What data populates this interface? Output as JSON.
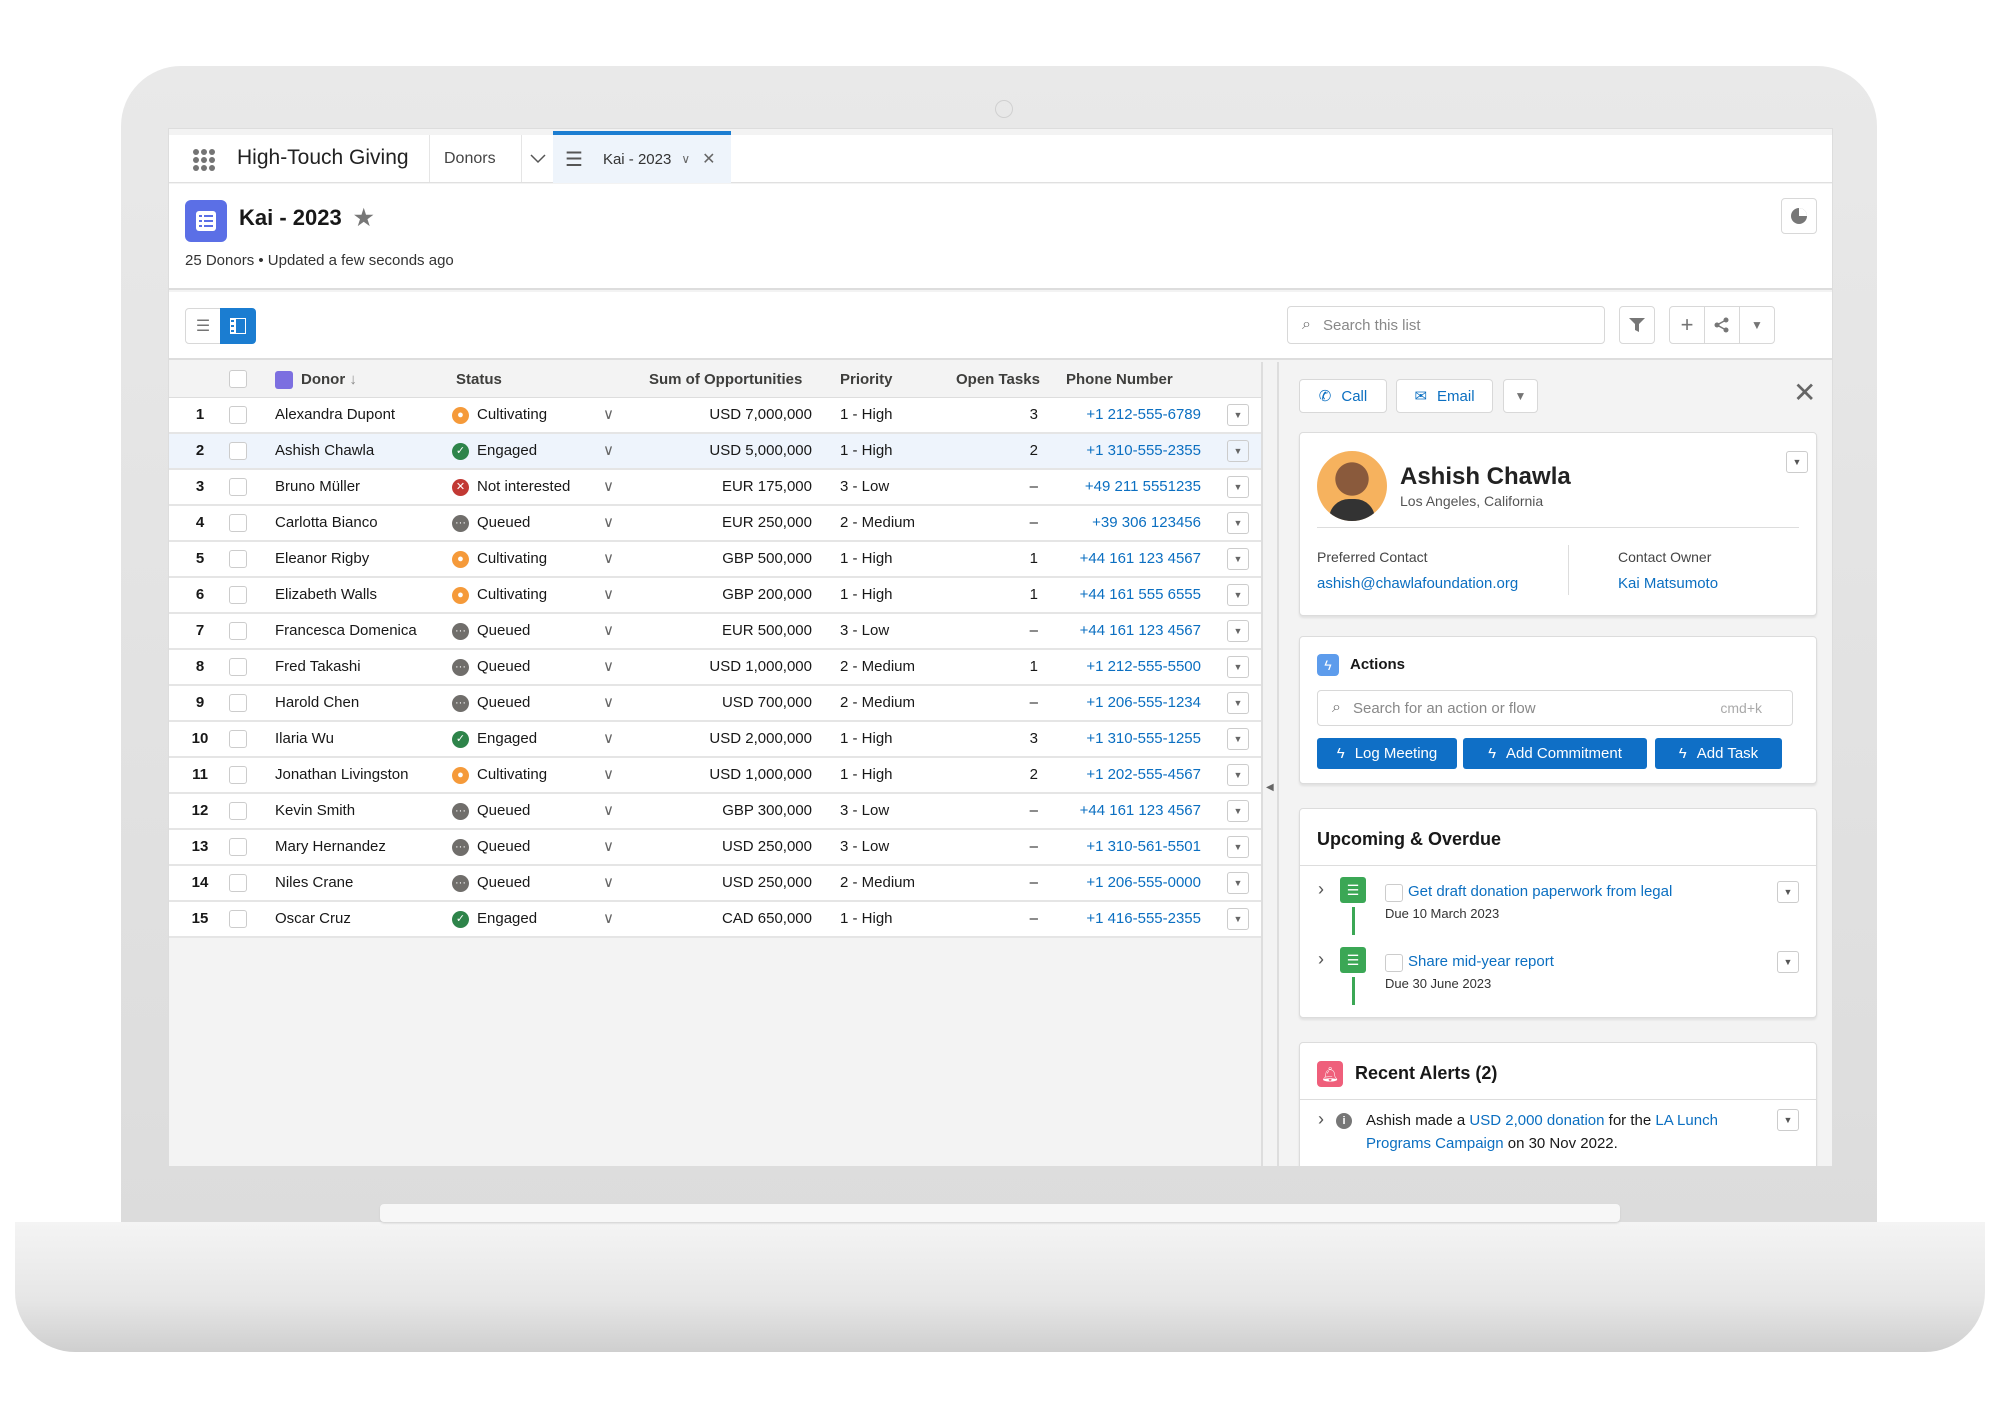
{
  "app": {
    "name": "High-Touch Giving",
    "nav_tab": "Donors",
    "active_tab": "Kai - 2023"
  },
  "header": {
    "title": "Kai - 2023",
    "subtitle": "25 Donors • Updated a few seconds ago"
  },
  "toolbar": {
    "search_placeholder": "Search this list"
  },
  "table": {
    "columns": {
      "donor": "Donor",
      "status": "Status",
      "sum": "Sum of Opportunities",
      "priority": "Priority",
      "tasks": "Open Tasks",
      "phone": "Phone Number"
    },
    "selected_row": 2,
    "status_colors": {
      "Cultivating": "#f59a3a",
      "Engaged": "#2e844a",
      "Not interested": "#c23934",
      "Queued": "#706e6b"
    },
    "rows": [
      {
        "n": "1",
        "donor": "Alexandra Dupont",
        "status": "Cultivating",
        "sum": "USD 7,000,000",
        "priority": "1 - High",
        "tasks": "3",
        "phone": "+1 212-555-6789"
      },
      {
        "n": "2",
        "donor": "Ashish Chawla",
        "status": "Engaged",
        "sum": "USD 5,000,000",
        "priority": "1 - High",
        "tasks": "2",
        "phone": "+1 310-555-2355"
      },
      {
        "n": "3",
        "donor": "Bruno Müller",
        "status": "Not interested",
        "sum": "EUR 175,000",
        "priority": "3 - Low",
        "tasks": "–",
        "phone": "+49 211 5551235"
      },
      {
        "n": "4",
        "donor": "Carlotta Bianco",
        "status": "Queued",
        "sum": "EUR 250,000",
        "priority": "2 - Medium",
        "tasks": "–",
        "phone": "+39 306 123456"
      },
      {
        "n": "5",
        "donor": "Eleanor Rigby",
        "status": "Cultivating",
        "sum": "GBP 500,000",
        "priority": "1 - High",
        "tasks": "1",
        "phone": "+44 161 123 4567"
      },
      {
        "n": "6",
        "donor": "Elizabeth Walls",
        "status": "Cultivating",
        "sum": "GBP 200,000",
        "priority": "1 - High",
        "tasks": "1",
        "phone": "+44 161 555 6555"
      },
      {
        "n": "7",
        "donor": "Francesca Domenica",
        "status": "Queued",
        "sum": "EUR 500,000",
        "priority": "3 - Low",
        "tasks": "–",
        "phone": "+44 161 123 4567"
      },
      {
        "n": "8",
        "donor": "Fred Takashi",
        "status": "Queued",
        "sum": "USD 1,000,000",
        "priority": "2 - Medium",
        "tasks": "1",
        "phone": "+1 212-555-5500"
      },
      {
        "n": "9",
        "donor": "Harold Chen",
        "status": "Queued",
        "sum": "USD 700,000",
        "priority": "2 - Medium",
        "tasks": "–",
        "phone": "+1 206-555-1234"
      },
      {
        "n": "10",
        "donor": "Ilaria Wu",
        "status": "Engaged",
        "sum": "USD 2,000,000",
        "priority": "1 - High",
        "tasks": "3",
        "phone": "+1 310-555-1255"
      },
      {
        "n": "11",
        "donor": "Jonathan Livingston",
        "status": "Cultivating",
        "sum": "USD 1,000,000",
        "priority": "1 - High",
        "tasks": "2",
        "phone": "+1 202-555-4567"
      },
      {
        "n": "12",
        "donor": "Kevin Smith",
        "status": "Queued",
        "sum": "GBP 300,000",
        "priority": "3 - Low",
        "tasks": "–",
        "phone": "+44 161 123 4567"
      },
      {
        "n": "13",
        "donor": "Mary Hernandez",
        "status": "Queued",
        "sum": "USD 250,000",
        "priority": "3 - Low",
        "tasks": "–",
        "phone": "+1 310-561-5501"
      },
      {
        "n": "14",
        "donor": "Niles Crane",
        "status": "Queued",
        "sum": "USD 250,000",
        "priority": "2 - Medium",
        "tasks": "–",
        "phone": "+1 206-555-0000"
      },
      {
        "n": "15",
        "donor": "Oscar Cruz",
        "status": "Engaged",
        "sum": "CAD 650,000",
        "priority": "1 - High",
        "tasks": "–",
        "phone": "+1 416-555-2355"
      }
    ]
  },
  "panel": {
    "call": "Call",
    "email": "Email",
    "contact": {
      "name": "Ashish Chawla",
      "location": "Los Angeles, California",
      "pref_label": "Preferred Contact",
      "pref_value": "ashish@chawlafoundation.org",
      "owner_label": "Contact Owner",
      "owner_value": "Kai Matsumoto"
    },
    "actions": {
      "title": "Actions",
      "search_placeholder": "Search for an action or flow",
      "shortcut": "cmd+k",
      "buttons": [
        "Log Meeting",
        "Add Commitment",
        "Add Task"
      ]
    },
    "upcoming": {
      "title": "Upcoming & Overdue",
      "tasks": [
        {
          "title": "Get draft donation paperwork from legal",
          "due": "Due 10 March 2023"
        },
        {
          "title": "Share mid-year report",
          "due": "Due 30 June 2023"
        }
      ]
    },
    "alerts": {
      "title": "Recent Alerts (2)",
      "items": [
        {
          "t1": "Ashish made a ",
          "l1": "USD 2,000 donation",
          "t2": " for the ",
          "l2": "LA Lunch Programs Campaign",
          "t3": " on 30 Nov 2022."
        }
      ]
    }
  },
  "colors": {
    "accent": "#0f6fc6",
    "link": "#0b6fc1",
    "list_icon": "#5b6fe6",
    "task_green": "#3ba755",
    "alert_pink": "#ef5f7b"
  }
}
